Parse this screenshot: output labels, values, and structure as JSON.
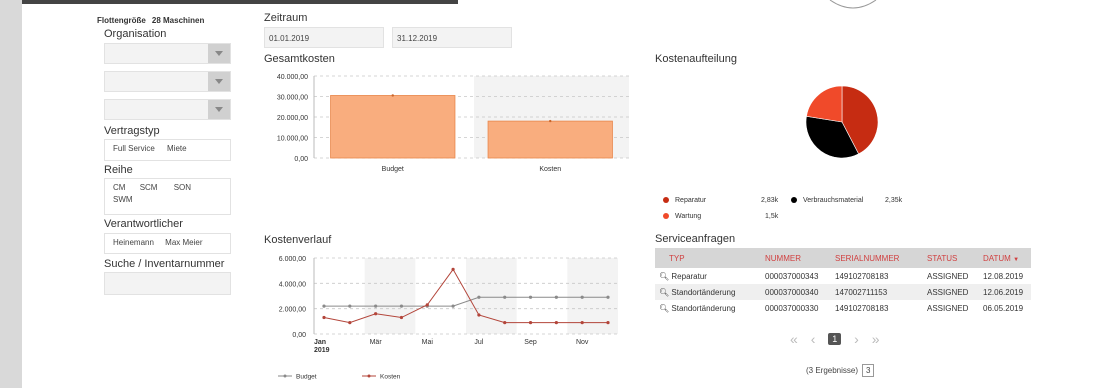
{
  "filters": {
    "fleet_size_label": "Flottengröße",
    "fleet_size_value": "28 Maschinen",
    "organisation_label": "Organisation",
    "vertragstyp_label": "Vertragstyp",
    "vertragstyp_options": [
      "Full Service",
      "Miete"
    ],
    "reihe_label": "Reihe",
    "reihe_options": [
      "CM",
      "SCM",
      "SON",
      "SWM"
    ],
    "verantwortlicher_label": "Verantwortlicher",
    "verantwortlicher_options": [
      "Heinemann",
      "Max Meier"
    ],
    "suche_label": "Suche / Inventarnummer"
  },
  "zeitraum": {
    "label": "Zeitraum",
    "from": "01.01.2019",
    "to": "31.12.2019"
  },
  "gesamtkosten": {
    "title": "Gesamtkosten",
    "y_ticks": [
      "40.000,00",
      "30.000,00",
      "20.000,00",
      "10.000,00",
      "0,00"
    ],
    "colors": {
      "bar": "#f9ad7e",
      "bar_border": "#e8874c"
    }
  },
  "kostenverlauf": {
    "title": "Kostenverlauf",
    "y_ticks": [
      "6.000,00",
      "4.000,00",
      "2.000,00",
      "0,00"
    ],
    "x_ticks": [
      "Jan",
      "2019",
      "Mär",
      "Mai",
      "Jul",
      "Sep",
      "Nov"
    ],
    "legend": [
      "Budget",
      "Kosten"
    ],
    "colors": {
      "budget": "#8a8a8a",
      "kosten": "#b3453a"
    }
  },
  "kostenaufteilung": {
    "title": "Kostenaufteilung",
    "items": [
      {
        "name": "Reparatur",
        "value": "2,83k",
        "color": "#c62c12"
      },
      {
        "name": "Verbrauchsmaterial",
        "value": "2,35k",
        "color": "#000000"
      },
      {
        "name": "Wartung",
        "value": "1,5k",
        "color": "#f04a2a"
      }
    ]
  },
  "serviceanfragen": {
    "title": "Serviceanfragen",
    "columns": [
      "TYP",
      "NUMMER",
      "SERIALNUMMER",
      "STATUS",
      "DATUM"
    ],
    "rows": [
      [
        "Reparatur",
        "000037000343",
        "149102708183",
        "ASSIGNED",
        "12.08.2019"
      ],
      [
        "Standortänderung",
        "000037000340",
        "147002711153",
        "ASSIGNED",
        "12.06.2019"
      ],
      [
        "Standortänderung",
        "000037000330",
        "149102708183",
        "ASSIGNED",
        "06.05.2019"
      ]
    ],
    "pager": {
      "first": "«",
      "prev": "‹",
      "current": "1",
      "next": "›",
      "last": "»"
    },
    "results_text": "(3 Ergebnisse)",
    "page_size": "3"
  },
  "chart_data": [
    {
      "type": "bar",
      "title": "Gesamtkosten",
      "categories": [
        "Budget",
        "Kosten"
      ],
      "values": [
        30500,
        18000
      ],
      "ylim": [
        0,
        40000
      ],
      "grid": true
    },
    {
      "type": "line",
      "title": "Kostenverlauf",
      "x": [
        "Jan",
        "Feb",
        "Mär",
        "Apr",
        "Mai",
        "Jun",
        "Jul",
        "Aug",
        "Sep",
        "Okt",
        "Nov",
        "Dez"
      ],
      "series": [
        {
          "name": "Budget",
          "values": [
            2200,
            2200,
            2200,
            2200,
            2200,
            2200,
            2900,
            2900,
            2900,
            2900,
            2900,
            2900
          ]
        },
        {
          "name": "Kosten",
          "values": [
            1300,
            900,
            1600,
            1300,
            2300,
            5100,
            1500,
            900,
            900,
            900,
            900,
            900
          ]
        }
      ],
      "ylim": [
        0,
        6000
      ],
      "grid": true,
      "legend_position": "bottom-left"
    },
    {
      "type": "pie",
      "title": "Kostenaufteilung",
      "categories": [
        "Reparatur",
        "Verbrauchsmaterial",
        "Wartung"
      ],
      "values": [
        2830,
        2350,
        1500
      ]
    }
  ]
}
